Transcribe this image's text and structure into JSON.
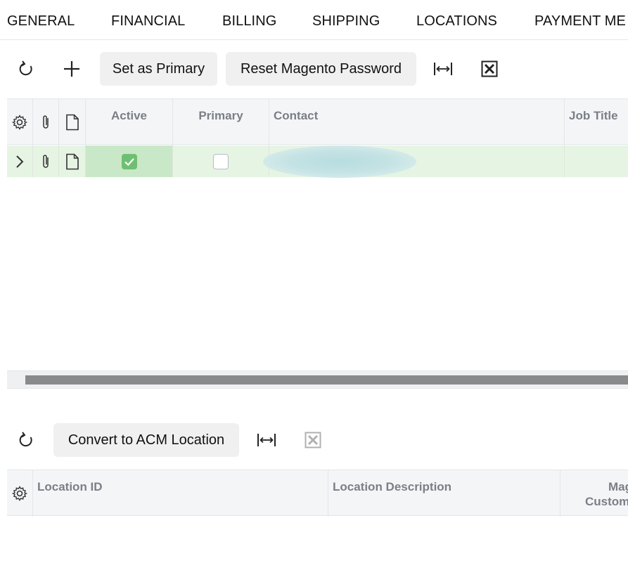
{
  "tabs": {
    "general": "GENERAL",
    "financial": "FINANCIAL",
    "billing": "BILLING",
    "shipping": "SHIPPING",
    "locations": "LOCATIONS",
    "payment": "PAYMENT ME"
  },
  "contacts_toolbar": {
    "refresh_icon": "refresh-icon",
    "add_icon": "plus-icon",
    "set_primary_label": "Set as Primary",
    "reset_password_label": "Reset Magento Password",
    "fit_icon": "fit-columns-icon",
    "export_icon": "excel-export-icon"
  },
  "contacts_grid": {
    "headers": {
      "active": "Active",
      "primary": "Primary",
      "contact": "Contact",
      "job_title": "Job Title"
    },
    "rows": [
      {
        "active": true,
        "primary": false,
        "contact": "",
        "job_title": ""
      }
    ]
  },
  "locations_toolbar": {
    "refresh_icon": "refresh-icon",
    "convert_label": "Convert to ACM Location",
    "fit_icon": "fit-columns-icon",
    "export_icon": "excel-export-icon"
  },
  "locations_grid": {
    "headers": {
      "location_id": "Location ID",
      "location_description": "Location Description",
      "magento_line1": "Mag",
      "magento_line2": "Custom"
    },
    "rows": []
  },
  "colors": {
    "active_row": "#e6f4e4",
    "active_cell": "#c9e8c7",
    "checkbox_checked": "#6fbf73",
    "header_bg": "#f4f5f7",
    "header_text": "#7a7f87"
  }
}
